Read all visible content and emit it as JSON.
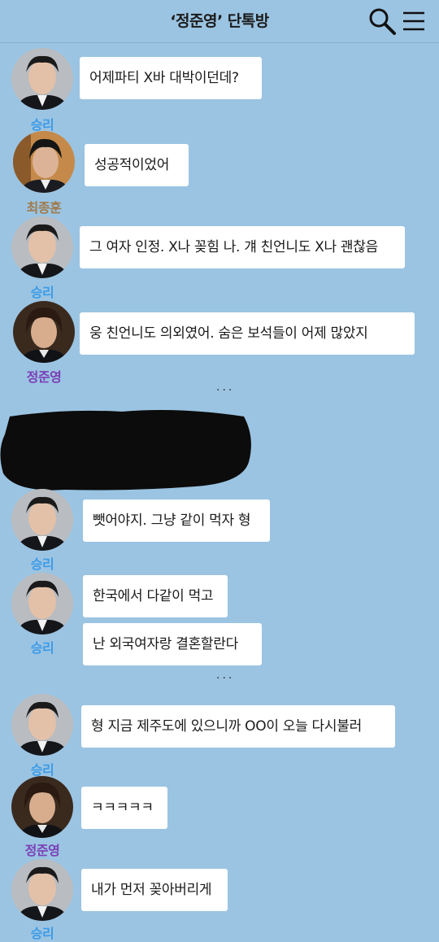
{
  "header": {
    "title": "‘정준영’ 단톡방",
    "search_icon": "search-icon",
    "menu_icon": "menu-icon"
  },
  "colors": {
    "background": "#9bc4e2",
    "seungri": "#3d9be6",
    "choi": "#a07a4c",
    "jung": "#7b3fb6"
  },
  "messages": [
    {
      "sender": "승리",
      "text": "어제파티 X바 대박이던데?"
    },
    {
      "sender": "최종훈",
      "text": "성공적이었어"
    },
    {
      "sender": "승리",
      "text": "그 여자 인정. X나 꽂힘 나. 걔 친언니도 X나 괜찮음"
    },
    {
      "sender": "정준영",
      "text": "웅 친언니도 의외였어. 숨은 보석들이 어제 많았지"
    },
    {
      "sender": "승리",
      "text": "뺏어야지. 그냥 같이 먹자 형"
    },
    {
      "sender": "승리",
      "text": "한국에서 다같이 먹고"
    },
    {
      "sender": "승리",
      "text": "난 외국여자랑 결혼할란다"
    },
    {
      "sender": "승리",
      "text": "형 지금 제주도에 있으니까 OO이 오늘 다시불러"
    },
    {
      "sender": "정준영",
      "text": "ㅋㅋㅋㅋㅋ"
    },
    {
      "sender": "승리",
      "text": "내가 먼저 꽂아버리게"
    }
  ],
  "separators": [
    "···",
    "···"
  ]
}
